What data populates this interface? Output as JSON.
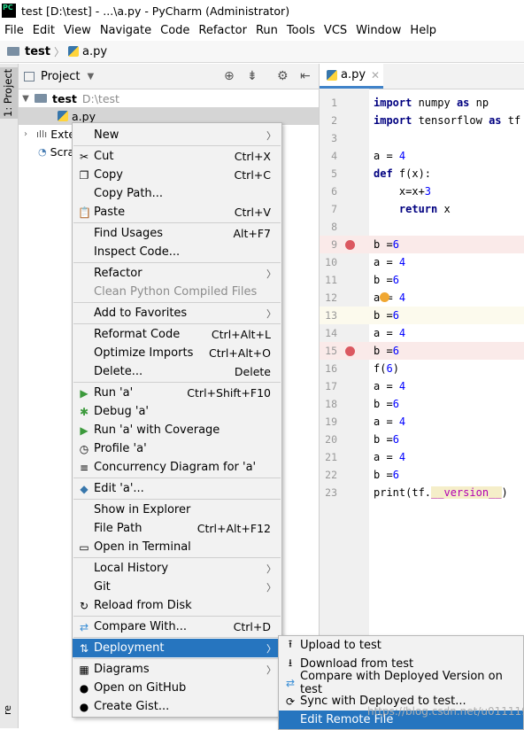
{
  "window": {
    "title": "test [D:\\test] - ...\\a.py - PyCharm (Administrator)",
    "logo": "PC"
  },
  "menubar": [
    "File",
    "Edit",
    "View",
    "Navigate",
    "Code",
    "Refactor",
    "Run",
    "Tools",
    "VCS",
    "Window",
    "Help"
  ],
  "breadcrumb": [
    "test",
    "a.py"
  ],
  "toolstrip": {
    "project_tab": "1: Project",
    "bottom": "re"
  },
  "project": {
    "header": "Project",
    "tree": [
      {
        "label": "test",
        "suffix": "D:\\test"
      },
      {
        "label": "a.py",
        "suffix": ""
      },
      {
        "label": "Exte",
        "suffix": ""
      },
      {
        "label": "Scra",
        "suffix": ""
      }
    ]
  },
  "editor": {
    "tab": "a.py",
    "lines": [
      {
        "n": "1",
        "code": "import numpy as np"
      },
      {
        "n": "2",
        "code": "import tensorflow as tf"
      },
      {
        "n": "3",
        "code": ""
      },
      {
        "n": "4",
        "code": "a = 4"
      },
      {
        "n": "5",
        "code": "def f(x):"
      },
      {
        "n": "6",
        "code": "    x=x+3"
      },
      {
        "n": "7",
        "code": "    return x"
      },
      {
        "n": "8",
        "code": ""
      },
      {
        "n": "9",
        "code": "b =6"
      },
      {
        "n": "10",
        "code": "a = 4"
      },
      {
        "n": "11",
        "code": "b =6"
      },
      {
        "n": "12",
        "code": "a = 4"
      },
      {
        "n": "13",
        "code": "b =6"
      },
      {
        "n": "14",
        "code": "a = 4"
      },
      {
        "n": "15",
        "code": "b =6"
      },
      {
        "n": "16",
        "code": "f(6)"
      },
      {
        "n": "17",
        "code": "a = 4"
      },
      {
        "n": "18",
        "code": "b =6"
      },
      {
        "n": "19",
        "code": "a = 4"
      },
      {
        "n": "20",
        "code": "b =6"
      },
      {
        "n": "21",
        "code": "a = 4"
      },
      {
        "n": "22",
        "code": "b =6"
      },
      {
        "n": "23",
        "code": "print(tf.__version__)"
      }
    ]
  },
  "context_menu": [
    {
      "label": "New",
      "shortcut": "",
      "submenu": true,
      "icon": ""
    },
    {
      "sep": true
    },
    {
      "label": "Cut",
      "shortcut": "Ctrl+X",
      "icon": "cut-icon"
    },
    {
      "label": "Copy",
      "shortcut": "Ctrl+C",
      "icon": "copy-icon"
    },
    {
      "label": "Copy Path...",
      "shortcut": ""
    },
    {
      "label": "Paste",
      "shortcut": "Ctrl+V",
      "icon": "paste-icon"
    },
    {
      "sep": true
    },
    {
      "label": "Find Usages",
      "shortcut": "Alt+F7"
    },
    {
      "label": "Inspect Code...",
      "shortcut": ""
    },
    {
      "sep": true
    },
    {
      "label": "Refactor",
      "shortcut": "",
      "submenu": true
    },
    {
      "label": "Clean Python Compiled Files",
      "shortcut": "",
      "disabled": true
    },
    {
      "sep": true
    },
    {
      "label": "Add to Favorites",
      "shortcut": "",
      "submenu": true
    },
    {
      "sep": true
    },
    {
      "label": "Reformat Code",
      "shortcut": "Ctrl+Alt+L"
    },
    {
      "label": "Optimize Imports",
      "shortcut": "Ctrl+Alt+O"
    },
    {
      "label": "Delete...",
      "shortcut": "Delete"
    },
    {
      "sep": true
    },
    {
      "label": "Run 'a'",
      "shortcut": "Ctrl+Shift+F10",
      "icon": "run-icon"
    },
    {
      "label": "Debug 'a'",
      "shortcut": "",
      "icon": "debug-icon"
    },
    {
      "label": "Run 'a' with Coverage",
      "shortcut": "",
      "icon": "coverage-icon"
    },
    {
      "label": "Profile 'a'",
      "shortcut": "",
      "icon": "profile-icon"
    },
    {
      "label": "Concurrency Diagram for 'a'",
      "shortcut": "",
      "icon": "concurrency-icon"
    },
    {
      "sep": true
    },
    {
      "label": "Edit 'a'...",
      "shortcut": "",
      "icon": "python-icon"
    },
    {
      "sep": true
    },
    {
      "label": "Show in Explorer",
      "shortcut": ""
    },
    {
      "label": "File Path",
      "shortcut": "Ctrl+Alt+F12"
    },
    {
      "label": "Open in Terminal",
      "shortcut": "",
      "icon": "terminal-icon"
    },
    {
      "sep": true
    },
    {
      "label": "Local History",
      "shortcut": "",
      "submenu": true
    },
    {
      "label": "Git",
      "shortcut": "",
      "submenu": true
    },
    {
      "label": "Reload from Disk",
      "shortcut": "",
      "icon": "reload-icon"
    },
    {
      "sep": true
    },
    {
      "label": "Compare With...",
      "shortcut": "Ctrl+D",
      "icon": "compare-icon"
    },
    {
      "sep": true
    },
    {
      "label": "Deployment",
      "shortcut": "",
      "submenu": true,
      "highlight": true,
      "icon": "deployment-icon"
    },
    {
      "sep": true
    },
    {
      "label": "Diagrams",
      "shortcut": "",
      "submenu": true,
      "icon": "diagram-icon"
    },
    {
      "label": "Open on GitHub",
      "shortcut": "",
      "icon": "github-icon"
    },
    {
      "label": "Create Gist...",
      "shortcut": "",
      "icon": "github-icon"
    }
  ],
  "deployment_submenu": [
    {
      "label": "Upload to test",
      "icon": "upload-icon"
    },
    {
      "label": "Download from test",
      "icon": "download-icon"
    },
    {
      "label": "Compare with Deployed Version on test",
      "icon": "compare-icon"
    },
    {
      "label": "Sync with Deployed to test...",
      "icon": "sync-icon"
    },
    {
      "label": "Edit Remote File",
      "highlight": true
    }
  ],
  "watermark": "https://blog.csdn.net/u011119817"
}
